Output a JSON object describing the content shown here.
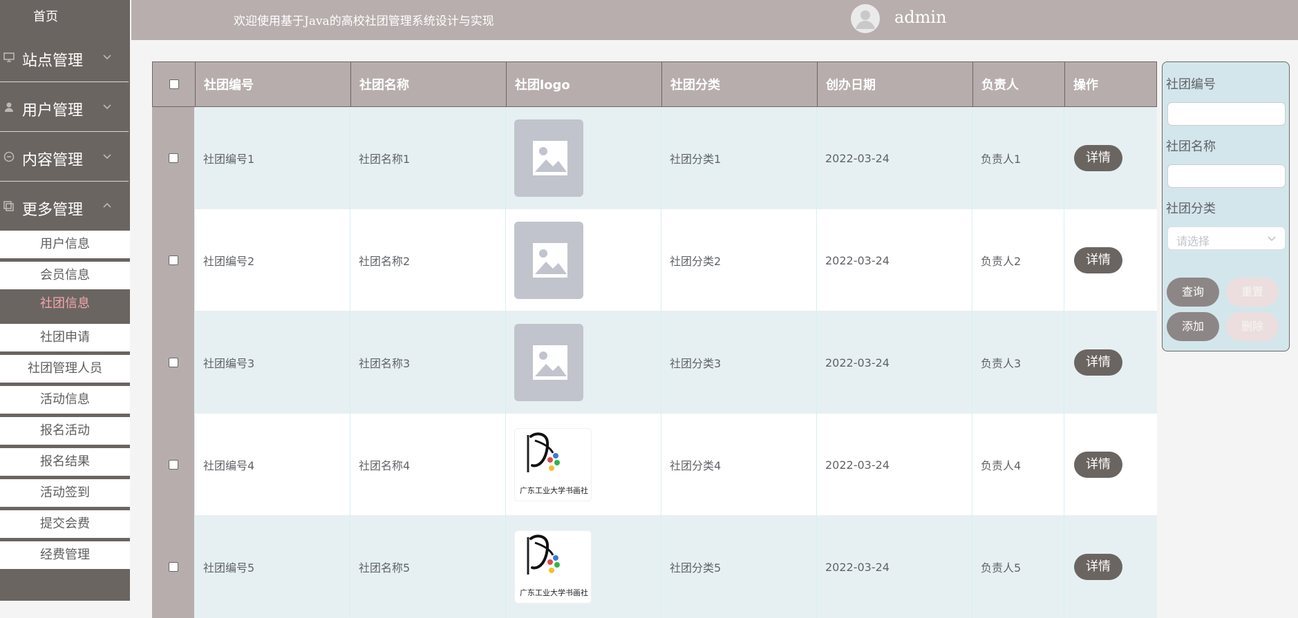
{
  "sidebar": {
    "home": "首页",
    "sections": [
      {
        "label": "站点管理",
        "icon": "monitor-icon"
      },
      {
        "label": "用户管理",
        "icon": "user-icon"
      },
      {
        "label": "内容管理",
        "icon": "chat-icon"
      },
      {
        "label": "更多管理",
        "icon": "copy-icon"
      }
    ],
    "submenu": [
      {
        "label": "用户信息",
        "active": false
      },
      {
        "label": "会员信息",
        "active": false
      },
      {
        "label": "社团信息",
        "active": true
      },
      {
        "label": "社团申请",
        "active": false
      },
      {
        "label": "社团管理人员",
        "active": false
      },
      {
        "label": "活动信息",
        "active": false
      },
      {
        "label": "报名活动",
        "active": false
      },
      {
        "label": "报名结果",
        "active": false
      },
      {
        "label": "活动签到",
        "active": false
      },
      {
        "label": "提交会费",
        "active": false
      },
      {
        "label": "经费管理",
        "active": false
      }
    ]
  },
  "header": {
    "welcome": "欢迎使用基于Java的高校社团管理系统设计与实现",
    "username": "admin"
  },
  "table": {
    "headers": [
      "",
      "社团编号",
      "社团名称",
      "社团logo",
      "社团分类",
      "创办日期",
      "负责人",
      "操作"
    ],
    "rows": [
      {
        "id": "社团编号1",
        "name": "社团名称1",
        "logo": "placeholder",
        "category": "社团分类1",
        "date": "2022-03-24",
        "owner": "负责人1",
        "action": "详情"
      },
      {
        "id": "社团编号2",
        "name": "社团名称2",
        "logo": "placeholder",
        "category": "社团分类2",
        "date": "2022-03-24",
        "owner": "负责人2",
        "action": "详情"
      },
      {
        "id": "社团编号3",
        "name": "社团名称3",
        "logo": "placeholder",
        "category": "社团分类3",
        "date": "2022-03-24",
        "owner": "负责人3",
        "action": "详情"
      },
      {
        "id": "社团编号4",
        "name": "社团名称4",
        "logo": "club-logo",
        "logo_caption": "广东工业大学书画社",
        "category": "社团分类4",
        "date": "2022-03-24",
        "owner": "负责人4",
        "action": "详情"
      },
      {
        "id": "社团编号5",
        "name": "社团名称5",
        "logo": "club-logo",
        "logo_caption": "广东工业大学书画社",
        "category": "社团分类5",
        "date": "2022-03-24",
        "owner": "负责人5",
        "action": "详情"
      }
    ]
  },
  "search": {
    "id_label": "社团编号",
    "name_label": "社团名称",
    "category_label": "社团分类",
    "category_placeholder": "请选择",
    "buttons": {
      "query": "查询",
      "reset": "重置",
      "add": "添加",
      "delete": "删除"
    }
  },
  "colors": {
    "sidebar": "#6b6561",
    "header": "#b8aeae",
    "table_header": "#b7adad",
    "row_alt": "#e6f0f2",
    "active_text": "#f2a7ae"
  }
}
